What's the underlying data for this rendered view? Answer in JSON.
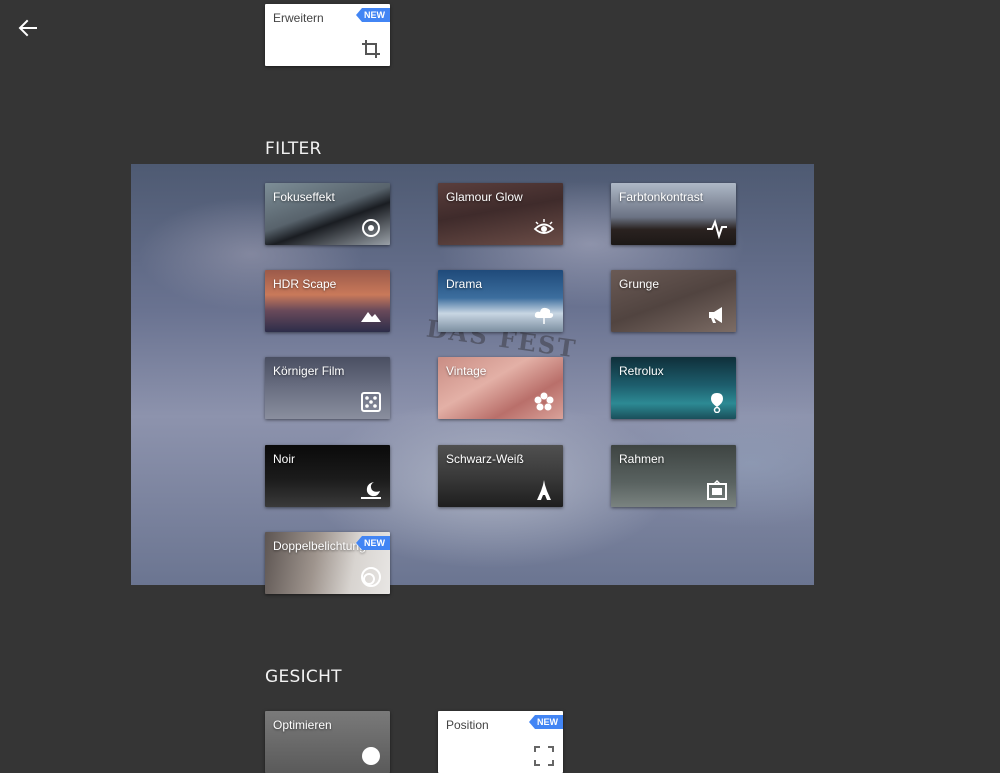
{
  "sections": {
    "filter_title": "FILTER",
    "face_title": "GESICHT"
  },
  "badge_new": "NEW",
  "tiles": {
    "erweitern": "Erweitern",
    "fokuseffekt": "Fokuseffekt",
    "glamour": "Glamour Glow",
    "farbton": "Farbtonkontrast",
    "hdr": "HDR Scape",
    "drama": "Drama",
    "grunge": "Grunge",
    "koerniger": "Körniger Film",
    "vintage": "Vintage",
    "retrolux": "Retrolux",
    "noir": "Noir",
    "schwarzweiss": "Schwarz-Weiß",
    "rahmen": "Rahmen",
    "doppel": "Doppelbelichtung",
    "optimieren": "Optimieren",
    "position": "Position"
  },
  "background_text": "DAS FEST",
  "icons": {
    "back": "arrow-left-icon",
    "erweitern": "crop-icon",
    "fokuseffekt": "target-icon",
    "glamour": "eye-icon",
    "farbton": "pulse-icon",
    "hdr": "mountain-icon",
    "drama": "cloud-icon",
    "grunge": "megaphone-icon",
    "koerniger": "dice-icon",
    "vintage": "flower-icon",
    "retrolux": "map-pin-icon",
    "noir": "moon-icon",
    "schwarzweiss": "tower-icon",
    "rahmen": "frame-icon",
    "doppel": "double-circle-icon",
    "optimieren": "smile-icon",
    "position": "face-focus-icon"
  },
  "colors": {
    "background": "#353535",
    "badge": "#4285f4"
  }
}
